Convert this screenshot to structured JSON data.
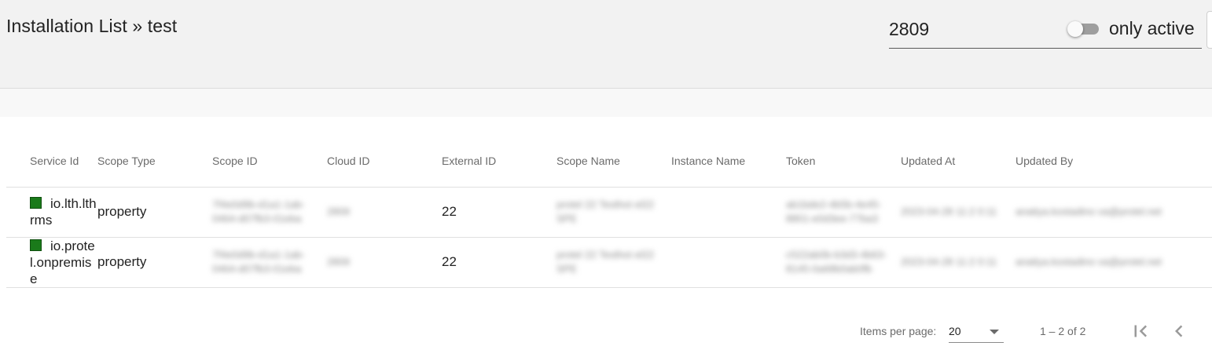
{
  "header": {
    "title": "Installation List » test",
    "search_value": "2809",
    "toggle_label": "only active",
    "toggle_on": false
  },
  "table": {
    "columns": [
      "Service Id",
      "Scope Type",
      "Scope ID",
      "Cloud ID",
      "External ID",
      "Scope Name",
      "Instance Name",
      "Token",
      "Updated At",
      "Updated By"
    ],
    "rows": [
      {
        "status_color": "#1a7a1a",
        "service_id": "io.lth.lthrms",
        "scope_type": "property",
        "scope_id": "7f4e0d9b-d1a1-1ab-0464-d07fb3-01eba",
        "cloud_id": "2809",
        "external_id": "22",
        "scope_name": "protel 22 Testhot el22 SPE",
        "instance_name": "",
        "token": "ab1bde2-4b5b-4e45-8801-e0d3ee-77ba3",
        "updated_at": "2023-04-28 11:2 0:11",
        "updated_by": "anatiya.kostadino va@protel.net"
      },
      {
        "status_color": "#1a7a1a",
        "service_id": "io.protel.onpremise",
        "scope_type": "property",
        "scope_id": "7f4e0d9b-d1a1-1ab-0464-d07fb3-01eba",
        "cloud_id": "2809",
        "external_id": "22",
        "scope_name": "protel 22 Testhot el22 SPE",
        "instance_name": "",
        "token": "c522ab0b-b3d3-4b63-8145-0a68b0ab0fb",
        "updated_at": "2023-04-28 11:2 0:11",
        "updated_by": "anatiya.kostadino va@protel.net"
      }
    ]
  },
  "paginator": {
    "items_per_page_label": "Items per page:",
    "items_per_page_value": "20",
    "range_label": "1 – 2 of 2"
  }
}
